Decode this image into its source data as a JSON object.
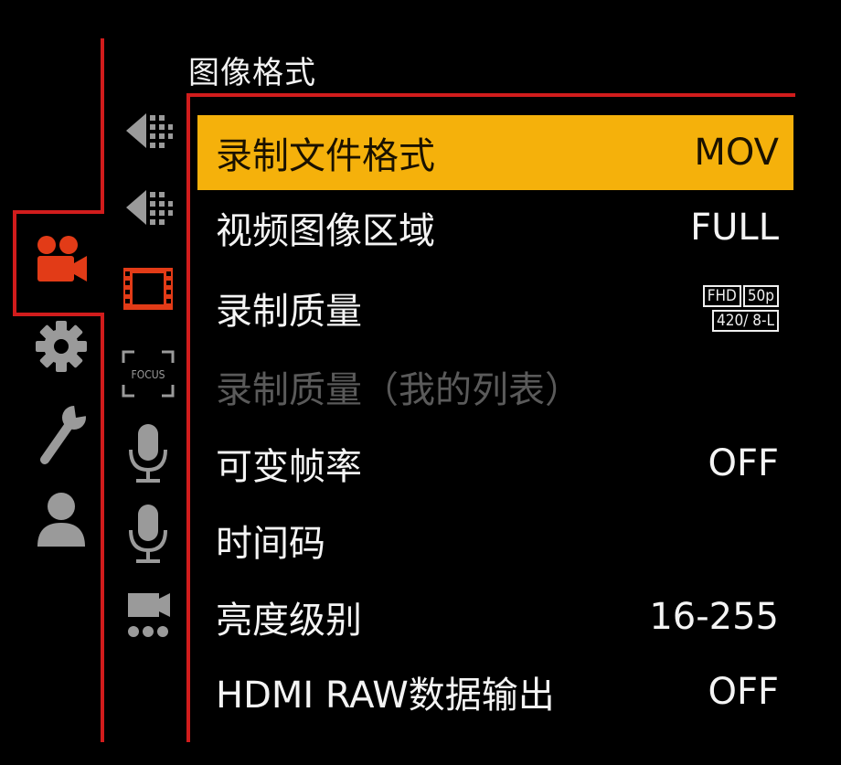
{
  "menu": {
    "title": "图像格式",
    "items": [
      {
        "label": "录制文件格式",
        "value": "MOV",
        "selected": true
      },
      {
        "label": "视频图像区域",
        "value": "FULL"
      },
      {
        "label": "录制质量",
        "badge": [
          "FHD",
          "50p",
          "420/ 8-L"
        ]
      },
      {
        "label": "录制质量（我的列表）",
        "value": "",
        "disabled": true
      },
      {
        "label": "可变帧率",
        "value": "OFF"
      },
      {
        "label": "时间码",
        "value": ""
      },
      {
        "label": "亮度级别",
        "value": "16-255"
      },
      {
        "label": "HDMI RAW数据输出",
        "value": "OFF"
      }
    ]
  },
  "left_tabs": [
    {
      "icon": "video-camera-icon",
      "active": true
    },
    {
      "icon": "gear-icon"
    },
    {
      "icon": "wrench-icon"
    },
    {
      "icon": "person-icon"
    }
  ],
  "sub_tabs": [
    {
      "icon": "photo-arrow-icon-1"
    },
    {
      "icon": "photo-arrow-icon-2"
    },
    {
      "icon": "film-strip-icon",
      "active": true
    },
    {
      "icon": "focus-icon",
      "text": "FOCUS"
    },
    {
      "icon": "microphone-icon-1"
    },
    {
      "icon": "microphone-icon-2"
    },
    {
      "icon": "camera-dots-icon"
    }
  ],
  "colors": {
    "accent": "#f5b10b",
    "frame_red": "#d11c1c",
    "active_icon": "#e23b17",
    "inactive_icon": "#9a9a9a"
  }
}
